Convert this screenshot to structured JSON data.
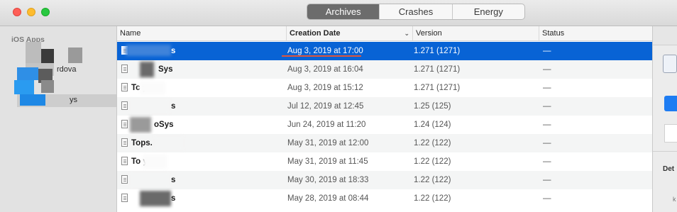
{
  "titlebar": {
    "tabs": [
      {
        "label": "Archives",
        "active": true
      },
      {
        "label": "Crashes",
        "active": false
      },
      {
        "label": "Energy",
        "active": false
      }
    ]
  },
  "sidebar": {
    "heading": "iOS Apps",
    "partial_items": [
      "rdova",
      "ys"
    ]
  },
  "table": {
    "columns": [
      {
        "label": "Name"
      },
      {
        "label": "Creation Date",
        "sorted": true,
        "sort_indicator": "chevron-down-icon"
      },
      {
        "label": "Version"
      },
      {
        "label": "Status"
      }
    ],
    "rows": [
      {
        "name": "s",
        "date": "Aug 3, 2019 at 17:00",
        "version": "1.271 (1271)",
        "status": "—",
        "selected": true
      },
      {
        "name": "Sys",
        "date": "Aug 3, 2019 at 16:04",
        "version": "1.271 (1271)",
        "status": "—"
      },
      {
        "name": "Tc           ys",
        "date": "Aug 3, 2019 at 15:12",
        "version": "1.271 (1271)",
        "status": "—"
      },
      {
        "name": "s",
        "date": "Jul 12, 2019 at 12:45",
        "version": "1.25 (125)",
        "status": "—"
      },
      {
        "name": "oSys",
        "date": "Jun 24, 2019 at 11:20",
        "version": "1.24 (124)",
        "status": "—"
      },
      {
        "name": "Tops.",
        "date": "May 31, 2019 at 12:00",
        "version": "1.22 (122)",
        "status": "—"
      },
      {
        "name": "To         ys",
        "date": "May 31, 2019 at 11:45",
        "version": "1.22 (122)",
        "status": "—"
      },
      {
        "name": "s",
        "date": "May 30, 2019 at 18:33",
        "version": "1.22 (122)",
        "status": "—"
      },
      {
        "name": "s",
        "date": "May 28, 2019 at 08:44",
        "version": "1.22 (122)",
        "status": "—"
      }
    ]
  },
  "inspector": {
    "label": "Det",
    "small": "k"
  },
  "colors": {
    "selection": "#0863d5",
    "accent_underline": "#e0563b",
    "segment_active": "#6c6c6c"
  }
}
